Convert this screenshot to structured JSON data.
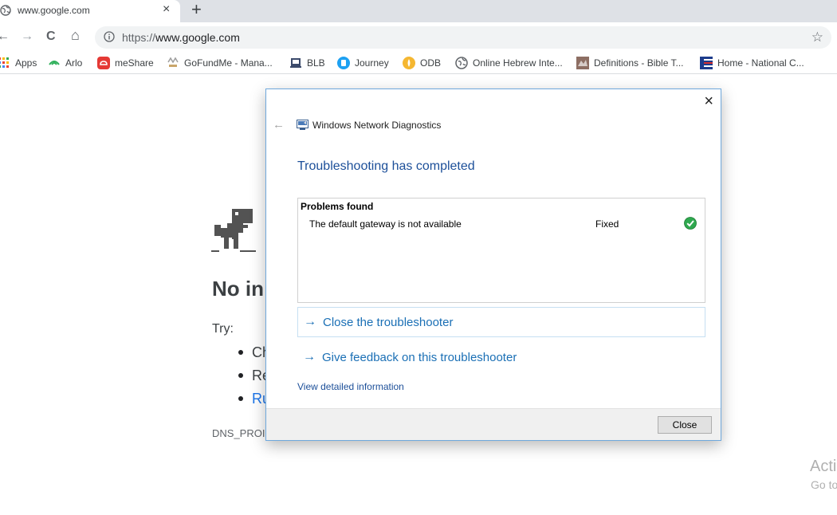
{
  "browser": {
    "tab": {
      "title": "www.google.com",
      "close": "×"
    },
    "new_tab": "+",
    "nav": {
      "back": "←",
      "forward": "→",
      "reload": "C",
      "home": "⌂"
    },
    "url": {
      "scheme": "https://",
      "host": "www.google.com"
    },
    "star": "☆"
  },
  "bookmarks": [
    {
      "label": "Apps",
      "icon": "apps-grid-icon",
      "color": "#ea4335"
    },
    {
      "label": "Arlo",
      "icon": "arlo-icon",
      "color": "#2fb05a"
    },
    {
      "label": "meShare",
      "icon": "meshare-icon",
      "color": "#e53935"
    },
    {
      "label": "GoFundMe - Mana...",
      "icon": "gofundme-icon",
      "color": "#9e9e9e"
    },
    {
      "label": "BLB",
      "icon": "blb-icon",
      "color": "#3b4a6b"
    },
    {
      "label": "Journey",
      "icon": "journey-icon",
      "color": "#1da1f2"
    },
    {
      "label": "ODB",
      "icon": "odb-icon",
      "color": "#f5b731"
    },
    {
      "label": "Online Hebrew Inte...",
      "icon": "globe-icon",
      "color": "#5f6368"
    },
    {
      "label": "Definitions - Bible T...",
      "icon": "bible-icon",
      "color": "#8d6e63"
    },
    {
      "label": "Home - National C...",
      "icon": "flag-icon",
      "color": "#1e3c8c"
    }
  ],
  "offline_page": {
    "title": "No in",
    "try_label": "Try:",
    "suggestions": [
      "Ch",
      "Re",
      "Ru"
    ],
    "error_code": "DNS_PROI"
  },
  "dialog": {
    "close_x": "×",
    "back": "←",
    "app_title": "Windows Network Diagnostics",
    "heading": "Troubleshooting has completed",
    "problems": {
      "header": "Problems found",
      "items": [
        {
          "name": "The default gateway is not available",
          "status": "Fixed"
        }
      ]
    },
    "links": [
      {
        "arrow": "→",
        "label": "Close the troubleshooter"
      },
      {
        "arrow": "→",
        "label": "Give feedback on this troubleshooter"
      }
    ],
    "detail_link": "View detailed information",
    "close_button": "Close"
  },
  "watermark": {
    "line1": "Acti",
    "line2": "Go to"
  },
  "colors": {
    "accent_link": "#1a6fb5",
    "dialog_border": "#6fa8dc",
    "status_fixed": "#2fa84f"
  }
}
